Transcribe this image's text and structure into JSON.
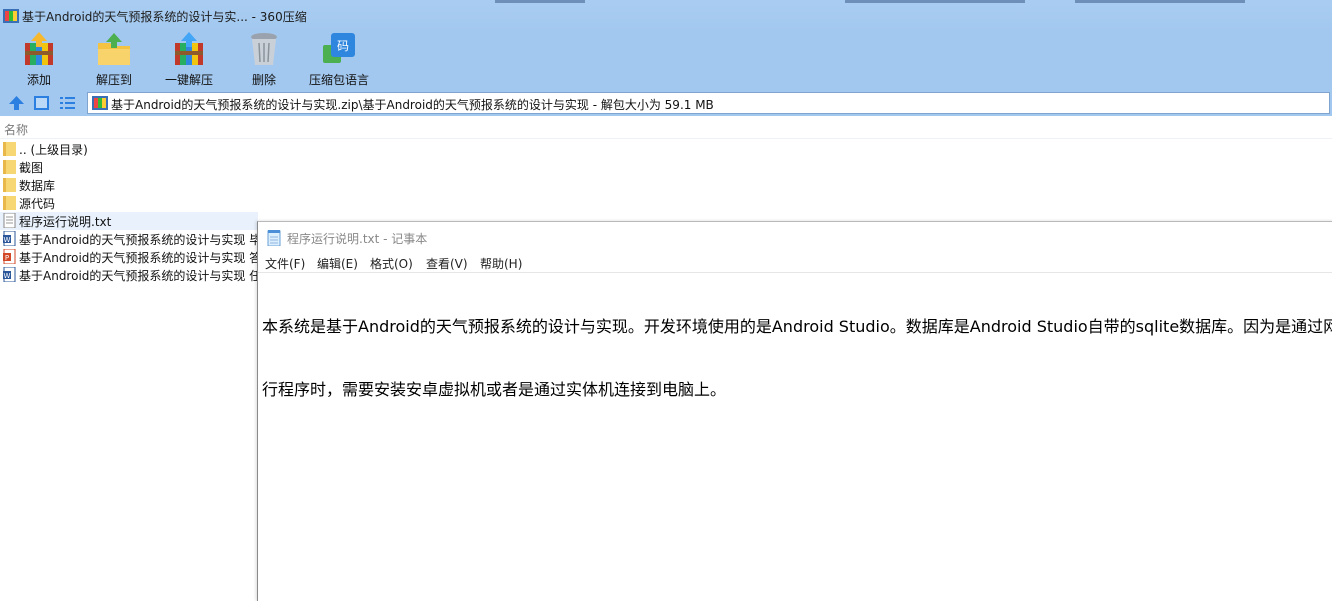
{
  "window": {
    "title": "基于Android的天气预报系统的设计与实... - 360压缩"
  },
  "toolbar": {
    "items": [
      {
        "label": "添加",
        "icon": "add-archive-icon"
      },
      {
        "label": "解压到",
        "icon": "extract-to-icon"
      },
      {
        "label": "一键解压",
        "icon": "one-click-extract-icon"
      },
      {
        "label": "删除",
        "icon": "delete-icon"
      },
      {
        "label": "压缩包语言",
        "icon": "archive-language-icon"
      }
    ]
  },
  "address": {
    "path": "基于Android的天气预报系统的设计与实现.zip\\基于Android的天气预报系统的设计与实现 - 解包大小为 59.1 MB"
  },
  "filelist": {
    "column_name": "名称",
    "rows": [
      {
        "name": ".. (上级目录)",
        "icon": "folder-icon"
      },
      {
        "name": "截图",
        "icon": "folder-icon"
      },
      {
        "name": "数据库",
        "icon": "folder-icon"
      },
      {
        "name": "源代码",
        "icon": "folder-icon"
      },
      {
        "name": "程序运行说明.txt",
        "icon": "text-file-icon"
      },
      {
        "name": "基于Android的天气预报系统的设计与实现 毕",
        "icon": "word-doc-icon"
      },
      {
        "name": "基于Android的天气预报系统的设计与实现 答",
        "icon": "ppt-icon"
      },
      {
        "name": "基于Android的天气预报系统的设计与实现 任",
        "icon": "word-doc-icon"
      }
    ]
  },
  "notepad": {
    "title": "程序运行说明.txt - 记事本",
    "menu": [
      "文件(F)",
      "编辑(E)",
      "格式(O)",
      "查看(V)",
      "帮助(H)"
    ],
    "lines": [
      "本系统是基于Android的天气预报系统的设计与实现。开发环境使用的是Android Studio。数据库是Android Studio自带的sqlite数据库。因为是通过网络",
      "行程序时，需要安装安卓虚拟机或者是通过实体机连接到电脑上。"
    ]
  },
  "colors": {
    "chrome": "#a3c8ef",
    "selection": "#e8f1fc",
    "folder": "#f7d674"
  }
}
